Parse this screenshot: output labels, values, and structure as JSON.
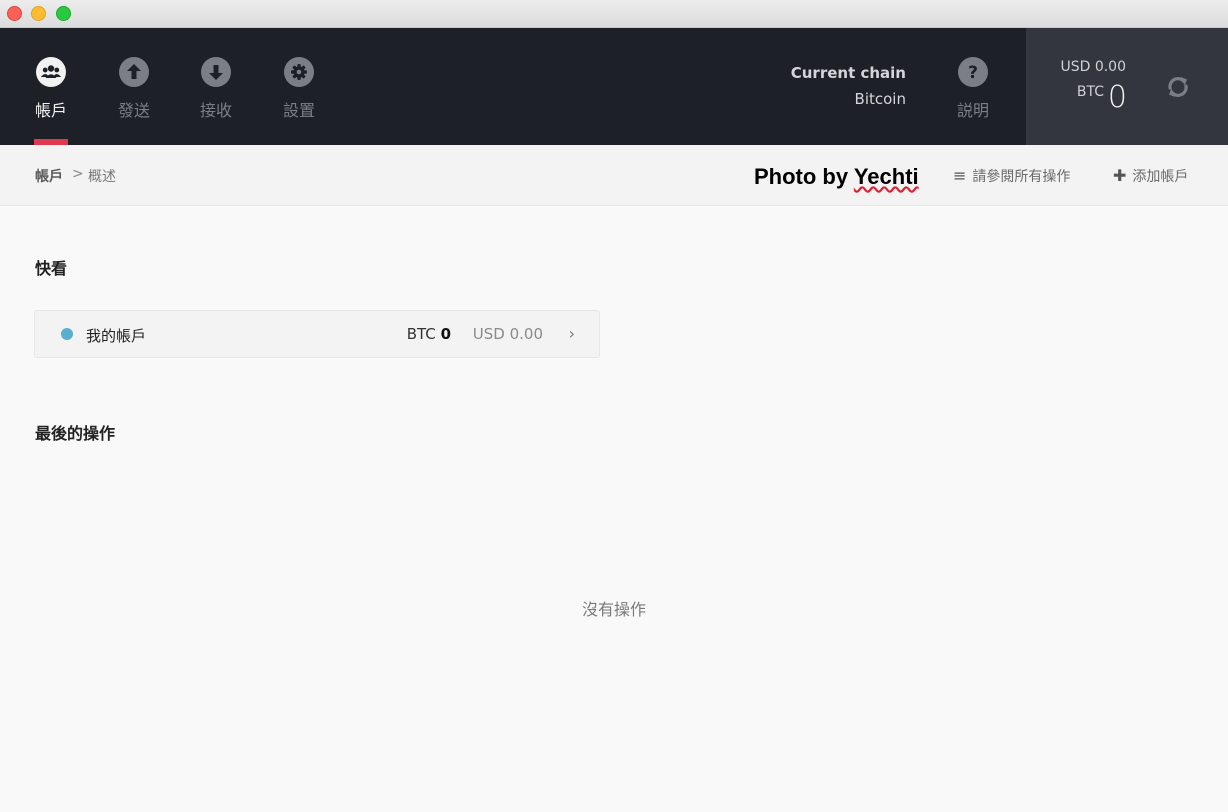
{
  "window": {
    "controls": [
      "close",
      "minimize",
      "zoom"
    ]
  },
  "nav": {
    "items": [
      {
        "label": "帳戶",
        "icon": "users-icon",
        "active": true
      },
      {
        "label": "發送",
        "icon": "arrow-up-icon",
        "active": false
      },
      {
        "label": "接收",
        "icon": "arrow-down-icon",
        "active": false
      },
      {
        "label": "設置",
        "icon": "gear-icon",
        "active": false
      }
    ],
    "help_label": "説明"
  },
  "chain": {
    "title": "Current chain",
    "value": "Bitcoin"
  },
  "balance": {
    "usd": "USD 0.00",
    "btc_label": "BTC",
    "btc_value": "0"
  },
  "breadcrumb": {
    "root": "帳戶",
    "separator": ">",
    "current": "概述"
  },
  "credit": {
    "prefix": "Photo by",
    "name": "Yechti"
  },
  "actions": {
    "view_all": "請參閱所有操作",
    "add_account": "添加帳戶"
  },
  "quick_view": {
    "title": "快看",
    "account": {
      "name": "我的帳戶",
      "btc_label": "BTC",
      "btc_value": "0",
      "usd": "USD 0.00",
      "dot_color": "#5aaecf"
    }
  },
  "recent": {
    "title": "最後的操作",
    "empty": "沒有操作"
  },
  "colors": {
    "topbar": "#1d2027",
    "accent": "#e0384c",
    "balance_bg": "#33363f"
  }
}
